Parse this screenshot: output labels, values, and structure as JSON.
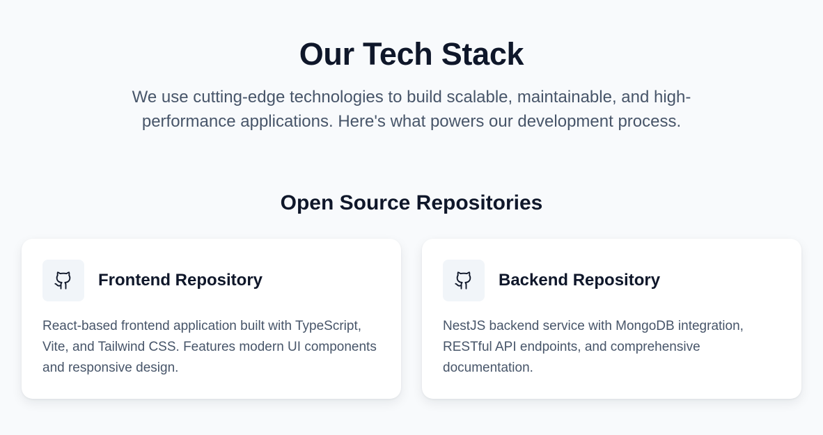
{
  "header": {
    "title": "Our Tech Stack",
    "subtitle": "We use cutting-edge technologies to build scalable, maintainable, and high-performance applications. Here's what powers our development process."
  },
  "repositories": {
    "section_title": "Open Source Repositories",
    "cards": [
      {
        "icon": "github-icon",
        "title": "Frontend Repository",
        "description": "React-based frontend application built with TypeScript, Vite, and Tailwind CSS. Features modern UI components and responsive design."
      },
      {
        "icon": "github-icon",
        "title": "Backend Repository",
        "description": "NestJS backend service with MongoDB integration, RESTful API endpoints, and comprehensive documentation."
      }
    ]
  },
  "colors": {
    "background": "#f8fafc",
    "heading": "#0f172a",
    "body_text": "#475569",
    "card_background": "#ffffff",
    "icon_background": "#f1f5f9"
  }
}
